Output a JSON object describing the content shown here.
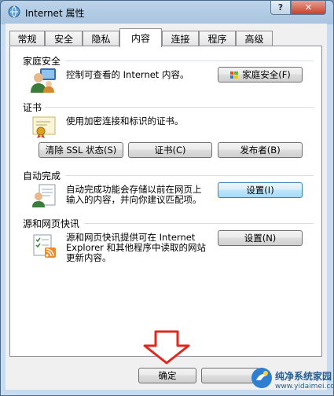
{
  "window": {
    "title": "Internet 属性"
  },
  "titlebar": {
    "help_label": "?",
    "close_label": "✕"
  },
  "tabs": [
    "常规",
    "安全",
    "隐私",
    "内容",
    "连接",
    "程序",
    "高级"
  ],
  "active_tab": "内容",
  "family_safety": {
    "title": "家庭安全",
    "description": "控制可查看的 Internet 内容。",
    "button_label": "家庭安全(F)"
  },
  "certificates": {
    "title": "证书",
    "description": "使用加密连接和标识的证书。",
    "clear_ssl_label": "清除 SSL 状态(S)",
    "certificates_label": "证书(C)",
    "publishers_label": "发布者(B)"
  },
  "autocomplete": {
    "title": "自动完成",
    "description_line1": "自动完成功能会存储以前在网页上",
    "description_line2": "输入的内容，并向你建议匹配项。",
    "settings_label": "设置(I)"
  },
  "feeds": {
    "title": "源和网页快讯",
    "description_line1": "源和网页快讯提供可在 Internet",
    "description_line2": "Explorer 和其他程序中读取的网站",
    "description_line3": "更新内容。",
    "settings_label": "设置(N)"
  },
  "footer": {
    "ok_label": "确定"
  },
  "watermark": {
    "text": "纯净系统家园",
    "url": "www.yidaimei.com"
  }
}
